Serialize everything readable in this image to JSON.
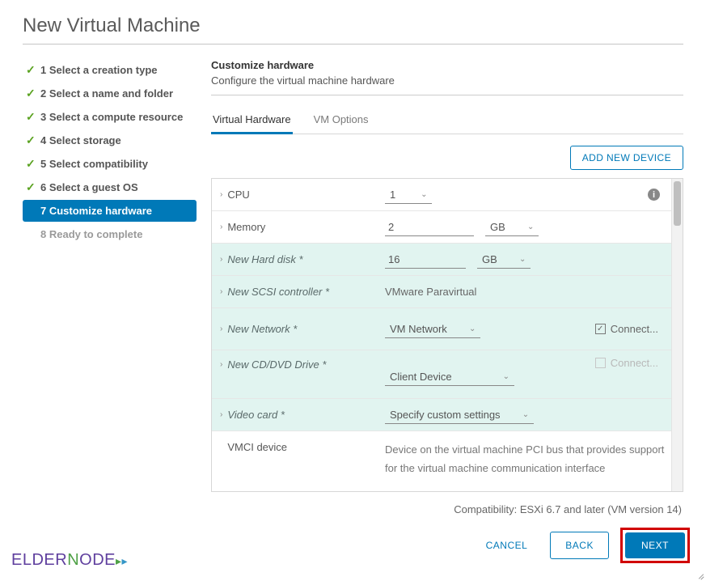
{
  "title": "New Virtual Machine",
  "sidebar": {
    "steps": [
      {
        "label": "1 Select a creation type"
      },
      {
        "label": "2 Select a name and folder"
      },
      {
        "label": "3 Select a compute resource"
      },
      {
        "label": "4 Select storage"
      },
      {
        "label": "5 Select compatibility"
      },
      {
        "label": "6 Select a guest OS"
      },
      {
        "label": "7 Customize hardware"
      },
      {
        "label": "8 Ready to complete"
      }
    ]
  },
  "main": {
    "section_title": "Customize hardware",
    "section_sub": "Configure the virtual machine hardware",
    "tabs": {
      "hw": "Virtual Hardware",
      "vm": "VM Options"
    },
    "add_device": "ADD NEW DEVICE",
    "rows": {
      "cpu": {
        "label": "CPU",
        "value": "1"
      },
      "memory": {
        "label": "Memory",
        "value": "2",
        "unit": "GB"
      },
      "disk": {
        "label": "New Hard disk *",
        "value": "16",
        "unit": "GB"
      },
      "scsi": {
        "label": "New SCSI controller *",
        "value": "VMware Paravirtual"
      },
      "net": {
        "label": "New Network *",
        "value": "VM Network",
        "connect": "Connect..."
      },
      "cd": {
        "label": "New CD/DVD Drive *",
        "value": "Client Device",
        "connect": "Connect..."
      },
      "video": {
        "label": "Video card *",
        "value": "Specify custom settings"
      },
      "vmci": {
        "label": "VMCI device",
        "value": "Device on the virtual machine PCI bus that provides support for the virtual machine communication interface"
      }
    },
    "compat": "Compatibility: ESXi 6.7 and later (VM version 14)"
  },
  "footer": {
    "cancel": "CANCEL",
    "back": "BACK",
    "next": "NEXT"
  },
  "logo": {
    "text1": "ELDER",
    "text2": "N",
    "text3": "DE"
  }
}
